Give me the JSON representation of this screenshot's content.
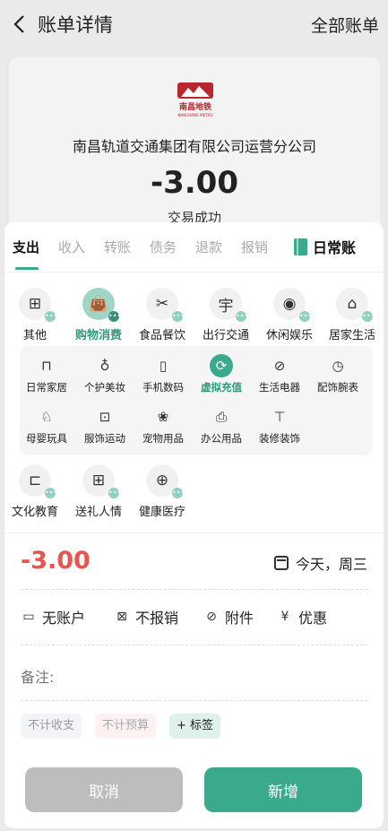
{
  "header": {
    "title": "账单详情",
    "all_bills": "全部账单"
  },
  "bill": {
    "logo_text": "南昌地铁",
    "logo_sub": "NANCHANG METRO",
    "company": "南昌轨道交通集团有限公司运营分公司",
    "amount": "-3.00",
    "status": "交易成功"
  },
  "tabs": [
    "支出",
    "收入",
    "转账",
    "债务",
    "退款",
    "报销"
  ],
  "book": {
    "label": "日常账"
  },
  "categories_row1": [
    {
      "label": "其他",
      "icon": "apps-icon",
      "glyph": "⊞"
    },
    {
      "label": "购物消费",
      "icon": "shopping-bag-icon",
      "glyph": "👜"
    },
    {
      "label": "食品餐饮",
      "icon": "fork-knife-icon",
      "glyph": "✂"
    },
    {
      "label": "出行交通",
      "icon": "transit-icon",
      "glyph": "宇"
    },
    {
      "label": "休闲娱乐",
      "icon": "gamepad-icon",
      "glyph": "◉"
    },
    {
      "label": "居家生活",
      "icon": "home-icon",
      "glyph": "⌂"
    }
  ],
  "subcategories_row1": [
    {
      "label": "日常家居",
      "icon": "furniture-icon",
      "glyph": "⊓"
    },
    {
      "label": "个护美妆",
      "icon": "cosmetics-icon",
      "glyph": "♁"
    },
    {
      "label": "手机数码",
      "icon": "phone-icon",
      "glyph": "▯"
    },
    {
      "label": "虚拟充值",
      "icon": "recharge-icon",
      "glyph": "⟳"
    },
    {
      "label": "生活电器",
      "icon": "appliance-icon",
      "glyph": "⊘"
    },
    {
      "label": "配饰腕表",
      "icon": "watch-icon",
      "glyph": "◷"
    }
  ],
  "subcategories_row2": [
    {
      "label": "母婴玩具",
      "icon": "baby-bottle-icon",
      "glyph": "♘"
    },
    {
      "label": "服饰运动",
      "icon": "clothing-icon",
      "glyph": "⊡"
    },
    {
      "label": "宠物用品",
      "icon": "paw-icon",
      "glyph": "❀"
    },
    {
      "label": "办公用品",
      "icon": "printer-icon",
      "glyph": "⎙"
    },
    {
      "label": "装修装饰",
      "icon": "paint-roller-icon",
      "glyph": "⊤"
    }
  ],
  "categories_row2": [
    {
      "label": "文化教育",
      "icon": "book-icon",
      "glyph": "⊏"
    },
    {
      "label": "送礼人情",
      "icon": "gift-icon",
      "glyph": "⊞"
    },
    {
      "label": "健康医疗",
      "icon": "medical-icon",
      "glyph": "⊕"
    }
  ],
  "entry": {
    "amount": "-3.00",
    "date": "今天，周三"
  },
  "options": [
    {
      "label": "无账户",
      "icon": "wallet-icon",
      "glyph": "▭"
    },
    {
      "label": "不报销",
      "icon": "no-reimburse-icon",
      "glyph": "⊠"
    },
    {
      "label": "附件",
      "icon": "paperclip-icon",
      "glyph": "⊘"
    },
    {
      "label": "优惠",
      "icon": "coupon-icon",
      "glyph": "¥"
    }
  ],
  "note_label": "备注:",
  "chips": {
    "exclude_income": "不计收支",
    "exclude_budget": "不计预算",
    "add_tag": "+ 标签"
  },
  "buttons": {
    "cancel": "取消",
    "add": "新增"
  },
  "colors": {
    "accent": "#3aaa8c",
    "expense": "#e8554e"
  }
}
